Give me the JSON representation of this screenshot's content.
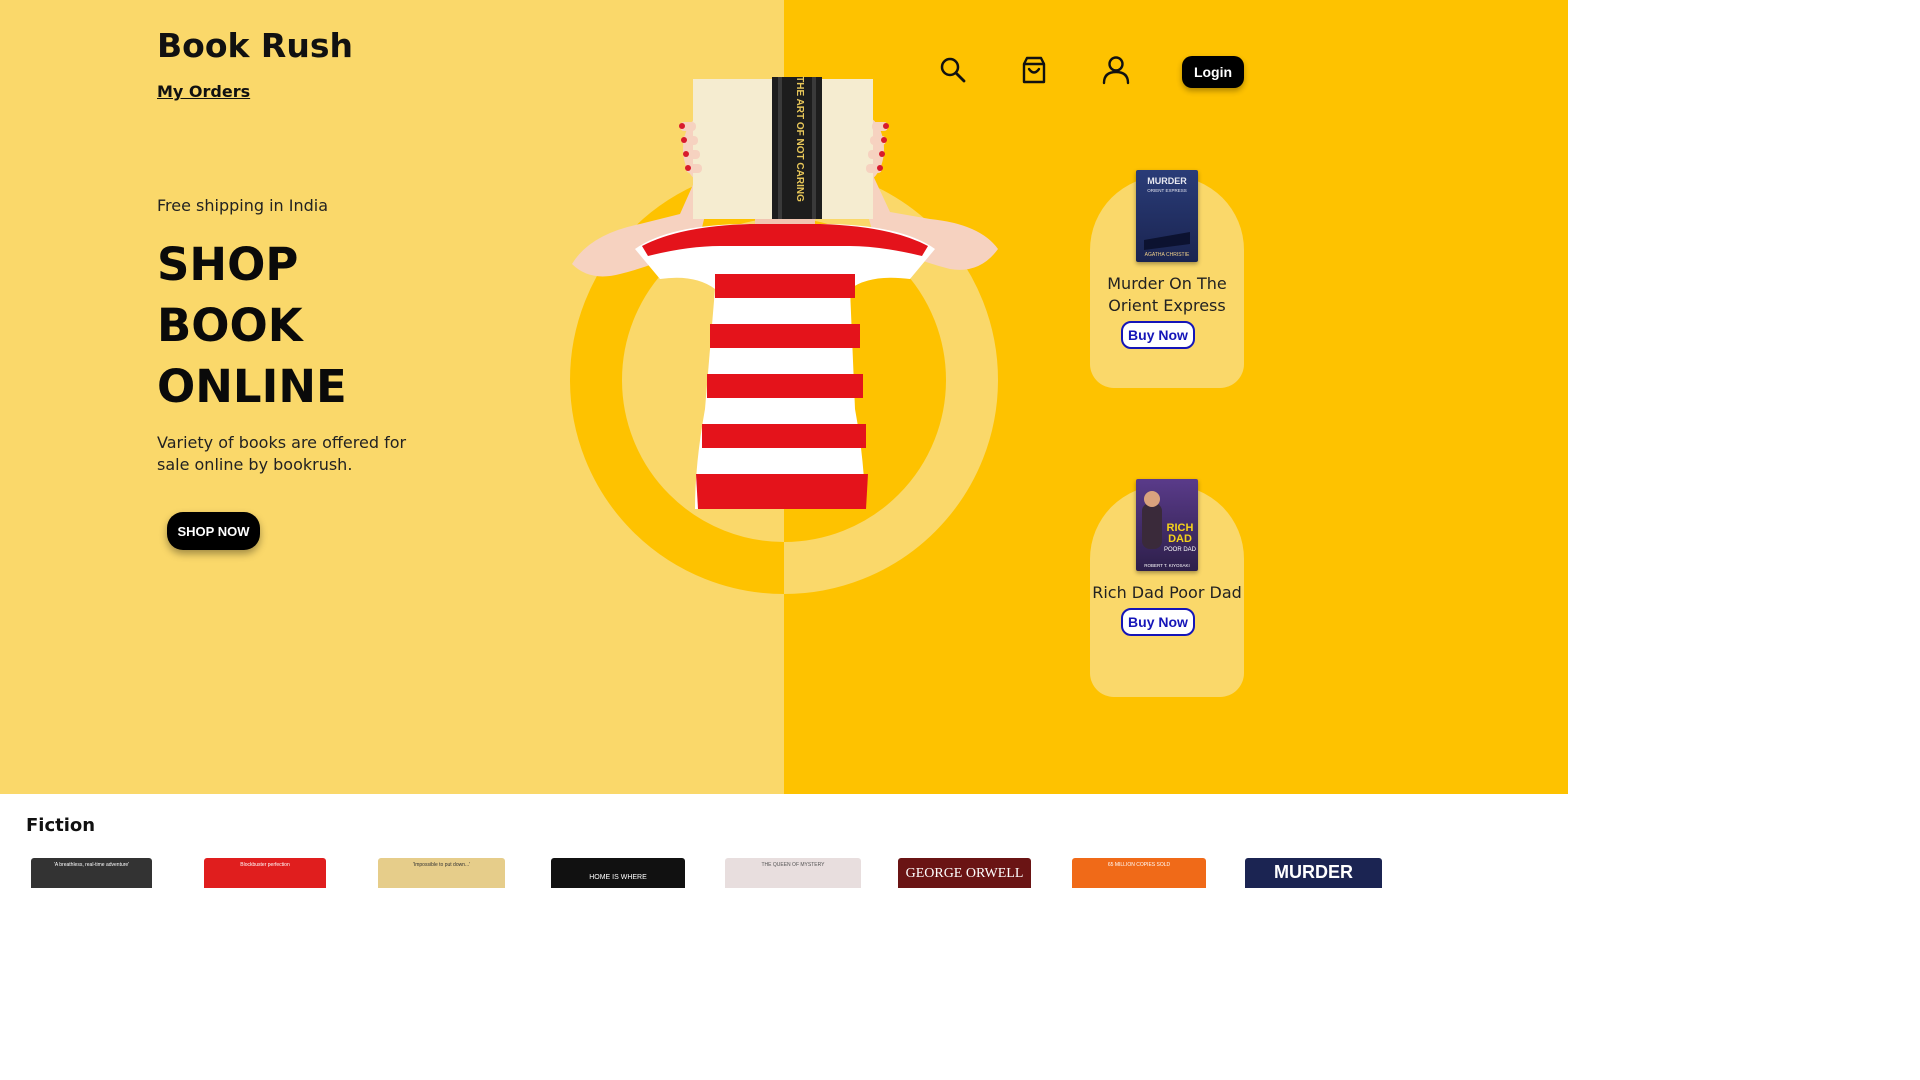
{
  "brand": "Book Rush",
  "nav": {
    "my_orders": "My Orders",
    "login": "Login"
  },
  "icons": [
    "search-icon",
    "cart-icon",
    "user-icon"
  ],
  "hero": {
    "tagline": "Free shipping in India",
    "headline": [
      "SHOP",
      "BOOK",
      "ONLINE"
    ],
    "description": "Variety of books are offered for sale online by bookrush.",
    "cta": "SHOP NOW",
    "book_spine": "THE ART OF NOT CARING"
  },
  "featured": [
    {
      "title": "Murder On The Orient Express",
      "button": "Buy Now",
      "cover_text": "MURDER ON THE ORIENT EXPRESS",
      "cover_author": "AGATHA CHRISTIE"
    },
    {
      "title": "Rich Dad Poor Dad",
      "button": "Buy Now",
      "cover_text": "RICH DAD POOR DAD",
      "cover_author": "ROBERT T. KIYOSAKI"
    }
  ],
  "sections": {
    "fiction": {
      "title": "Fiction",
      "books": [
        {
          "color": "#333333",
          "text": "'A breathless, real-time adventure'"
        },
        {
          "color": "#e01e1e",
          "text": "Blockbuster perfection"
        },
        {
          "color": "#e6cd8a",
          "text": "'Impossible to put down...'"
        },
        {
          "color": "#111111",
          "text": "HOME IS WHERE"
        },
        {
          "color": "#e8dede",
          "text": "THE QUEEN OF MYSTERY"
        },
        {
          "color": "#6a1414",
          "text": "GEORGE ORWELL"
        },
        {
          "color": "#f06a18",
          "text": "65 MILLION COPIES SOLD"
        },
        {
          "color": "#1b2452",
          "text": "MURDER"
        }
      ]
    }
  },
  "colors": {
    "hero_left": "#fad86a",
    "hero_right": "#fec200",
    "buy_button": "#1515b8"
  }
}
